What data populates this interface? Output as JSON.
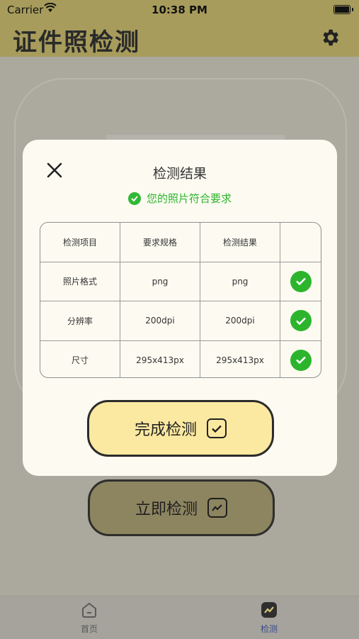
{
  "status": {
    "carrier": "Carrier",
    "time": "10:38 PM"
  },
  "nav": {
    "title": "证件照检测"
  },
  "main": {
    "detect_button_label": "立即检测"
  },
  "tabs": [
    {
      "label": "首页",
      "icon": "home-icon"
    },
    {
      "label": "检测",
      "icon": "chart-icon",
      "selected": true
    }
  ],
  "modal": {
    "title": "检测结果",
    "status_text": "您的照片符合要求",
    "columns": [
      "检测项目",
      "要求规格",
      "检测结果",
      ""
    ],
    "rows": [
      {
        "item": "照片格式",
        "spec": "png",
        "result": "png",
        "passed": true
      },
      {
        "item": "分辨率",
        "spec": "200dpi",
        "result": "200dpi",
        "passed": true
      },
      {
        "item": "尺寸",
        "spec": "295x413px",
        "result": "295x413px",
        "passed": true
      }
    ],
    "finish_button_label": "完成检测"
  },
  "colors": {
    "header": "#a79c5c",
    "pass_green": "#2cb52c",
    "finish_button": "#fce9a1",
    "tab_active": "#3c4b8a"
  }
}
